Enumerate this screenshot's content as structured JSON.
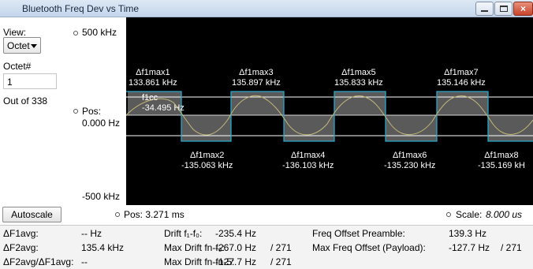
{
  "window": {
    "title": "Bluetooth Freq Dev vs Time",
    "close_glyph": "×"
  },
  "left": {
    "view_label": "View:",
    "view_value": "Octet",
    "octet_label": "Octet#",
    "octet_value": "1",
    "out_of": "Out of  338"
  },
  "plot": {
    "y_top": "500 kHz",
    "y_pos_label": "Pos:",
    "y_pos_value": "0.000 Hz",
    "y_bottom": "-500 kHz",
    "annotations": [
      {
        "name": "Δf1max1",
        "value": "133.861 kHz"
      },
      {
        "name": "Δf1max3",
        "value": "135.897 kHz"
      },
      {
        "name": "Δf1max5",
        "value": "135.833 kHz"
      },
      {
        "name": "Δf1max7",
        "value": "135.146 kHz"
      },
      {
        "name": "Δf1max2",
        "value": "-135.063 kHz"
      },
      {
        "name": "Δf1max4",
        "value": "-136.103 kHz"
      },
      {
        "name": "Δf1max6",
        "value": "-135.230 kHz"
      },
      {
        "name": "Δf1max8",
        "value": "-135.169 kH"
      }
    ],
    "fcenter_label": "f1cc",
    "fcenter_value": "-34.495 Hz",
    "colors": {
      "background": "#000000",
      "square_wave": "#2aa7c9",
      "sine_trace": "#c2b87a",
      "fill": "#5a5a5a",
      "ref_line": "#ffffff"
    }
  },
  "controls": {
    "autoscale_label": "Autoscale",
    "x_pos": "Pos: 3.271 ms",
    "scale_label": "Scale:",
    "scale_value": "8.000 us"
  },
  "results": {
    "row1": {
      "l1": "ΔF1avg:",
      "v1": "-- Hz",
      "l2": "Drift f₁-f₀:",
      "v2": "-235.4 Hz",
      "l3": "Freq Offset Preamble:",
      "v3": "139.3 Hz"
    },
    "row2": {
      "l1": "ΔF2avg:",
      "v1": "135.4 kHz",
      "l2": "Max Drift fn-f₀:",
      "v2": "-267.0 Hz",
      "c2": "/  271",
      "l3": "Max Freq Offset (Payload):",
      "v3": "-127.7 Hz",
      "c3": "/  271"
    },
    "row3": {
      "l1": "ΔF2avg/ΔF1avg:",
      "v1": "--",
      "l2": "Max Drift fn-fn-5:",
      "v2": "-127.7 Hz",
      "c2": "/  271"
    }
  }
}
